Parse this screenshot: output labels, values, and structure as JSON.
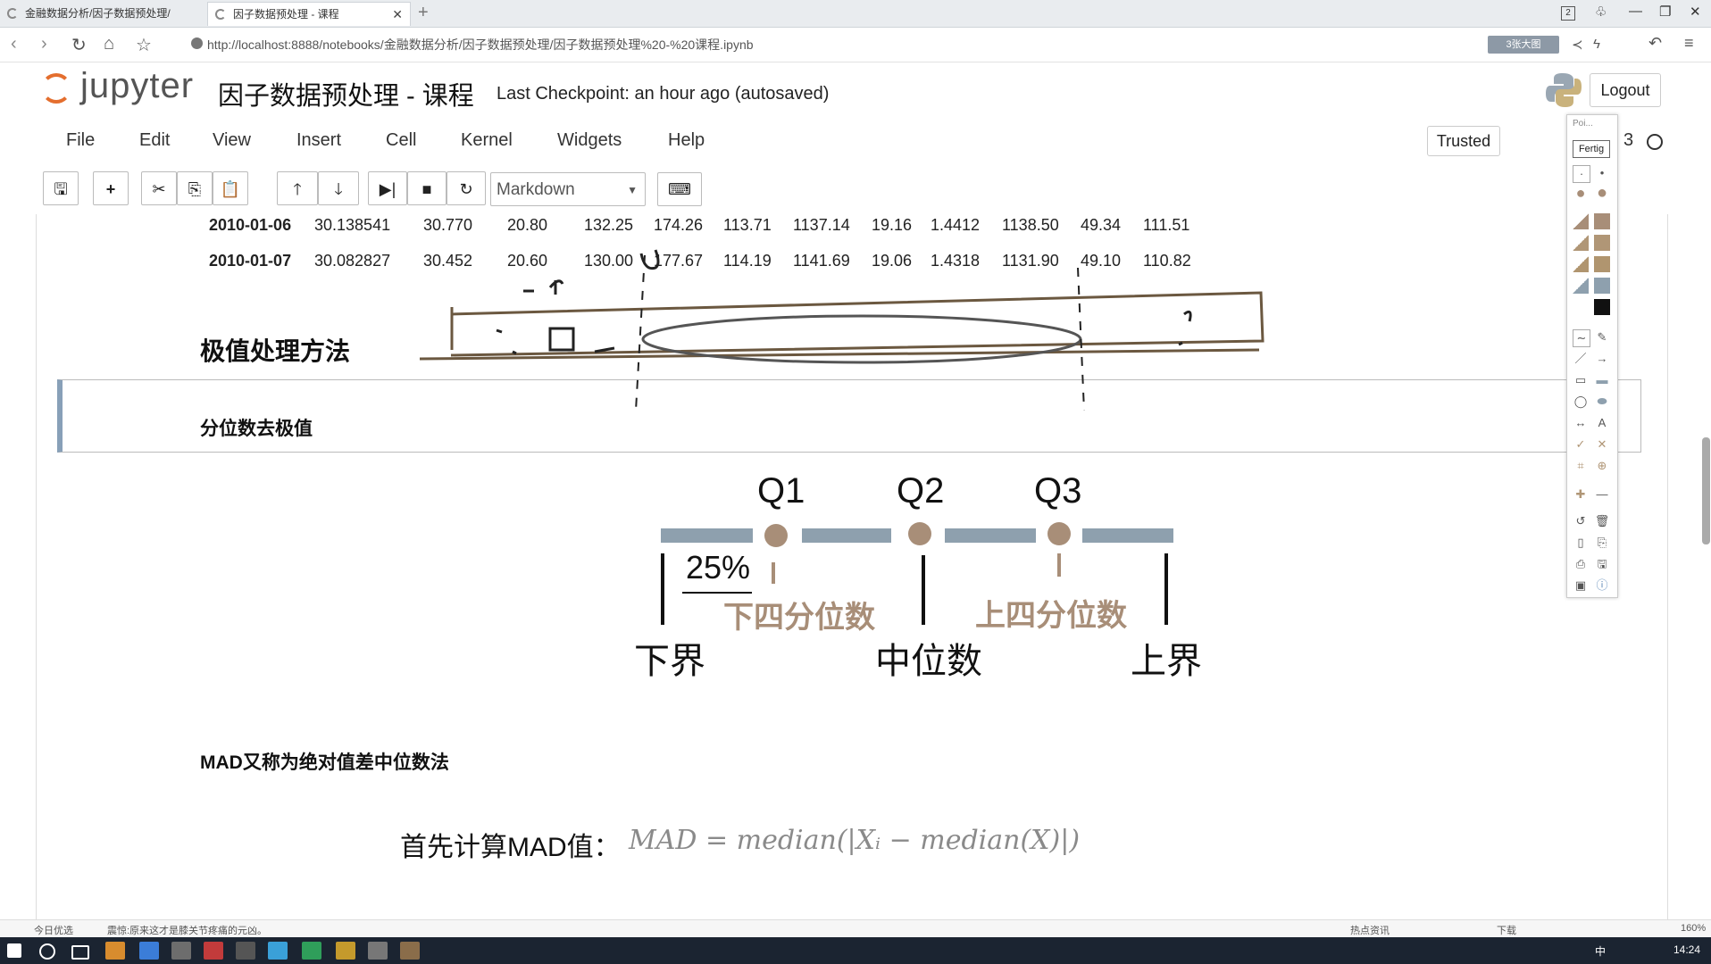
{
  "browser": {
    "tabs": [
      {
        "label": "金融数据分析/因子数据预处理/"
      },
      {
        "label": "因子数据预处理 - 课程"
      }
    ],
    "url": "http://localhost:8888/notebooks/金融数据分析/因子数据预处理/因子数据预处理%20-%20课程.ipynb",
    "ext_badge": "3张大图",
    "window_count": "2"
  },
  "jupyter": {
    "logo_text": "jupyter",
    "notebook_title": "因子数据预处理 - 课程",
    "checkpoint": "Last Checkpoint: an hour ago (autosaved)",
    "logout_label": "Logout",
    "trusted_label": "Trusted",
    "kernel_label": "3",
    "menu": [
      "File",
      "Edit",
      "View",
      "Insert",
      "Cell",
      "Kernel",
      "Widgets",
      "Help"
    ],
    "cell_type": "Markdown"
  },
  "table_rows": [
    {
      "date": "2010-01-06",
      "cells": [
        "30.138541",
        "30.770",
        "20.80",
        "132.25",
        "174.26",
        "113.71",
        "1137.14",
        "19.16",
        "1.4412",
        "1138.50",
        "49.34",
        "111.51"
      ]
    },
    {
      "date": "2010-01-07",
      "cells": [
        "30.082827",
        "30.452",
        "20.60",
        "130.00",
        "177.67",
        "114.19",
        "1141.69",
        "19.06",
        "1.4318",
        "1131.90",
        "49.10",
        "110.82"
      ]
    }
  ],
  "content": {
    "h_extreme": "极值处理方法",
    "h_quantile": "分位数去极值",
    "q1": "Q1",
    "q2": "Q2",
    "q3": "Q3",
    "pct": "25%",
    "lower_quartile": "下四分位数",
    "upper_quartile": "上四分位数",
    "lower_bound": "下界",
    "median": "中位数",
    "upper_bound": "上界",
    "mad_title": "MAD又称为绝对值差中位数法",
    "mad_lead": "首先计算MAD值：",
    "mad_formula": "MAD = median(|Xᵢ − median(X)|)"
  },
  "palette": {
    "header": "Poi...",
    "tooltip": "Fertig",
    "text_tool": "A"
  },
  "statusbar": {
    "left": "今日优选",
    "news": "震惊:原来这才是膝关节疼痛的元凶。",
    "hot": "热点资讯",
    "download": "下载",
    "zoom": "160%"
  },
  "taskbar": {
    "clock": "14:24",
    "ime": "中"
  },
  "colors": {
    "accent_bar": "#8ea0ae",
    "dot": "#a88e78",
    "brand_jupyter": "#e46e2e",
    "selected_cell": "#88a0b8"
  }
}
